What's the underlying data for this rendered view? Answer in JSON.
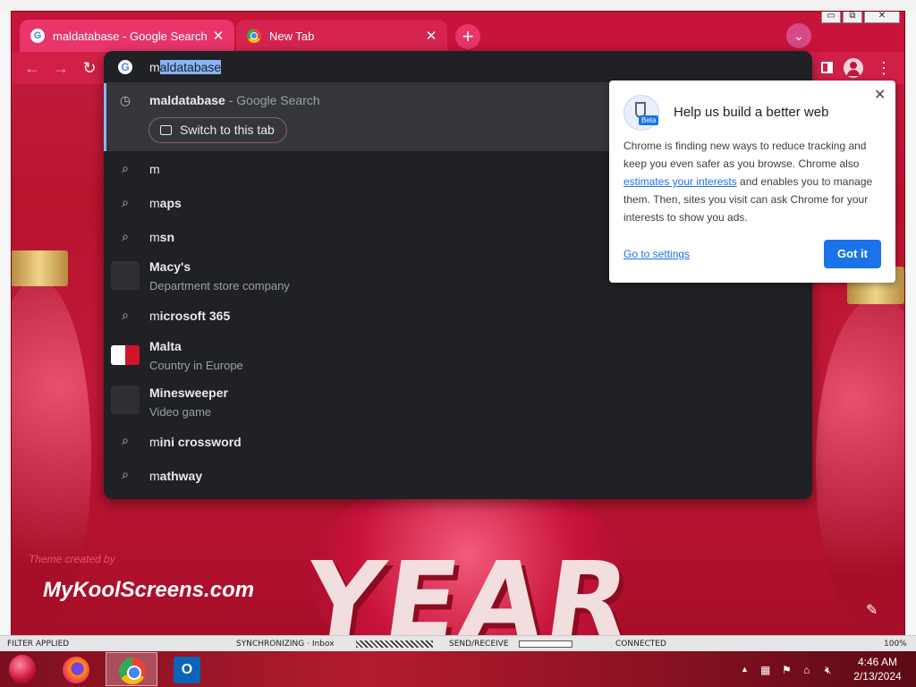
{
  "browser": {
    "tabs": [
      {
        "title": "maldatabase - Google Search",
        "favicon": "google-g-icon",
        "active": true
      },
      {
        "title": "New Tab",
        "favicon": "chrome-icon",
        "active": false
      }
    ],
    "new_tab_symbol": "+",
    "tab_search_symbol": "⌄",
    "window_controls": [
      "▭",
      "⧉",
      "✕"
    ]
  },
  "toolbar": {
    "back": "←",
    "forward": "→",
    "reload": "↻",
    "sidebar_icon": "side-panel-icon",
    "menu": "⋮"
  },
  "omnibox": {
    "typed": "m",
    "completion": "aldatabase",
    "active_suggestion": {
      "bold": "maldatabase",
      "suffix": " - Google Search",
      "icon": "history-clock-icon",
      "switch_label": "Switch to this tab"
    },
    "suggestions": [
      {
        "type": "search",
        "main_bold": "m",
        "main_rest": "",
        "sub": ""
      },
      {
        "type": "search",
        "main_bold": "m",
        "main_rest": "aps",
        "sub": ""
      },
      {
        "type": "search",
        "main_bold": "m",
        "main_rest": "sn",
        "sub": ""
      },
      {
        "type": "entity",
        "main_bold": "M",
        "main_rest": "acy's",
        "sub": "Department store company"
      },
      {
        "type": "search",
        "main_bold": "m",
        "main_rest": "icrosoft 365",
        "sub": ""
      },
      {
        "type": "entity-flag",
        "main_bold": "M",
        "main_rest": "alta",
        "sub": "Country in Europe"
      },
      {
        "type": "entity",
        "main_bold": "M",
        "main_rest": "inesweeper",
        "sub": "Video game"
      },
      {
        "type": "search",
        "main_bold": "m",
        "main_rest": "ini crossword",
        "sub": ""
      },
      {
        "type": "search",
        "main_bold": "m",
        "main_rest": "athway",
        "sub": ""
      }
    ]
  },
  "popup": {
    "title": "Help us build a better web",
    "badge": "Beta",
    "body_before": "Chrome is finding new ways to reduce tracking and keep you even safer as you browse. Chrome also ",
    "body_link": "estimates your interests",
    "body_after": " and enables you to manage them. Then, sites you visit can ask Chrome for your interests to show you ads.",
    "settings_link": "Go to settings",
    "button": "Got it",
    "close": "✕"
  },
  "page": {
    "brand": "MyKoolScreens.com",
    "theme_credit": "Theme created by",
    "hero_text": "YEAR",
    "edit_icon": "✎"
  },
  "outlook_status": {
    "filter": "FILTER APPLIED",
    "sync": "SYNCHRONIZING · Inbox",
    "send": "SEND/RECEIVE",
    "connected": "CONNECTED",
    "zoom": "100%"
  },
  "taskbar": {
    "apps": [
      "firefox-icon",
      "chrome-icon",
      "outlook-icon"
    ],
    "outlook_letter": "O",
    "tray_up": "▲",
    "time": "4:46 AM",
    "date": "2/13/2024"
  },
  "colors": {
    "theme_red": "#c8133a",
    "omnibox_bg": "#202124",
    "accent_blue": "#1a73e8"
  }
}
